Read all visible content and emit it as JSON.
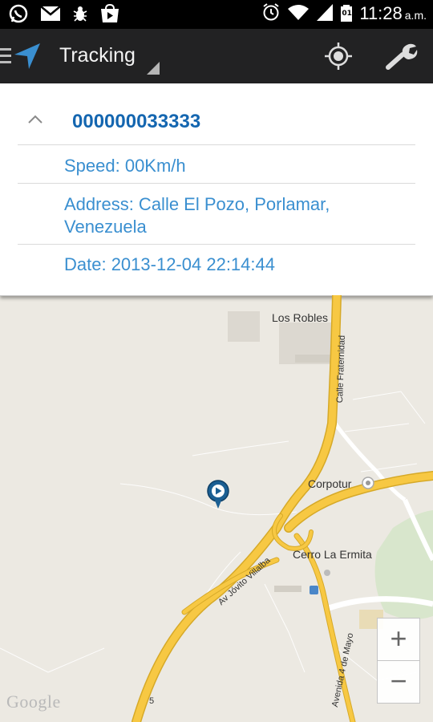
{
  "status_bar": {
    "time": "11:28",
    "ampm": "a.m.",
    "calendar_day": "01",
    "icons": [
      "whatsapp-icon",
      "gmail-icon",
      "bug-icon",
      "play-store-icon",
      "alarm-icon",
      "wifi-icon",
      "signal-icon",
      "battery-icon"
    ]
  },
  "action_bar": {
    "title": "Tracking",
    "icons": [
      "menu-icon",
      "navigation-arrow-icon",
      "locate-icon",
      "settings-wrench-icon"
    ]
  },
  "info_card": {
    "device_id": "000000033333",
    "speed": "Speed: 00Km/h",
    "address": "Address: Calle El Pozo, Porlamar, Venezuela",
    "date": "Date: 2013-12-04 22:14:44"
  },
  "map": {
    "places": {
      "los_robles": "Los Robles",
      "corpotur": "Corpotur",
      "cerro_la_ermita": "Cerro La Ermita"
    },
    "roads": {
      "calle_fraternidad": "Calle Fraternidad",
      "av_jovito_villalba": "Av Jóvito Villalba",
      "avenida_4_de_mayo": "Avenida 4 de Mayo",
      "route_5": "5"
    },
    "attribution": "Google",
    "zoom_in": "+",
    "zoom_out": "−"
  },
  "colors": {
    "accent": "#1466b0",
    "info_text": "#3a8fd0",
    "road": "#f7c843",
    "map_bg": "#ece9e2"
  }
}
